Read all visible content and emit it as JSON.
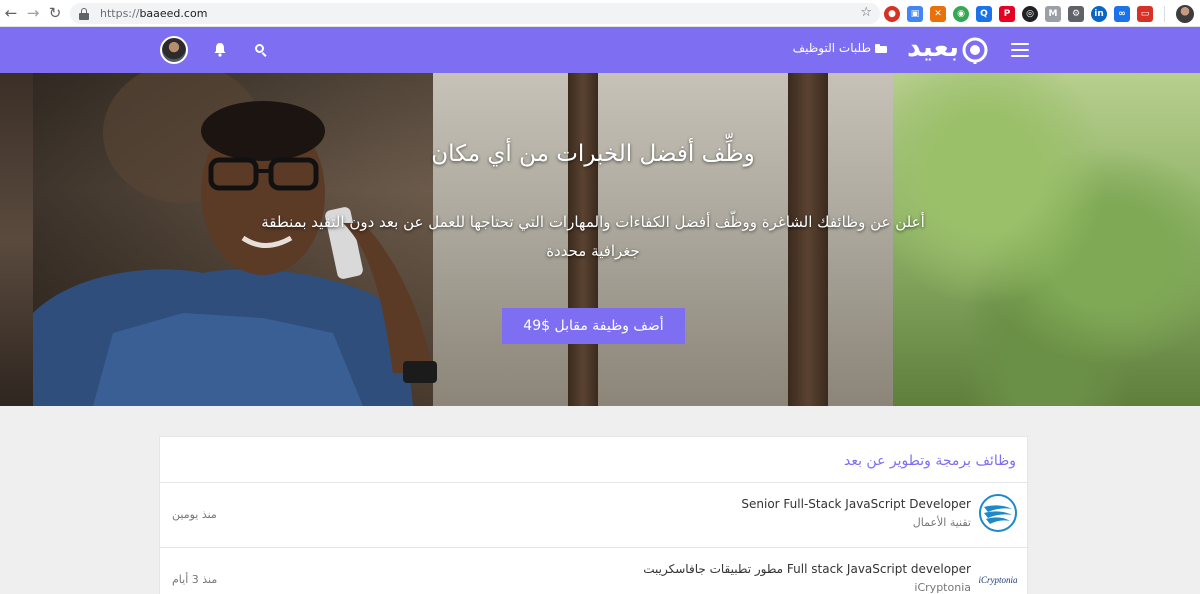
{
  "browser": {
    "url_scheme": "https://",
    "url_host": "baaeed.com",
    "extensions": [
      {
        "name": "adblock-icon",
        "color": "#d93025",
        "glyph": "●"
      },
      {
        "name": "translate-icon",
        "color": "#4285f4",
        "glyph": "▣"
      },
      {
        "name": "tools-icon",
        "color": "#e8710a",
        "glyph": "✕"
      },
      {
        "name": "globe-icon",
        "color": "#34a853",
        "glyph": "◉"
      },
      {
        "name": "qr-icon",
        "color": "#1a73e8",
        "glyph": "Q"
      },
      {
        "name": "pinterest-icon",
        "color": "#e60023",
        "glyph": "P"
      },
      {
        "name": "record-icon",
        "color": "#202124",
        "glyph": "◎"
      },
      {
        "name": "mail-icon",
        "color": "#9aa0a6",
        "glyph": "M"
      },
      {
        "name": "gear-ext-icon",
        "color": "#5f6368",
        "glyph": "⚙"
      },
      {
        "name": "linkedin-icon",
        "color": "#0a66c2",
        "glyph": "in"
      },
      {
        "name": "link-icon",
        "color": "#1a73e8",
        "glyph": "∞"
      },
      {
        "name": "screenshot-icon",
        "color": "#d93025",
        "glyph": "▭"
      }
    ]
  },
  "header": {
    "logo_text": "بعيد",
    "jobs_link_label": "طلبات التوظيف",
    "brand_color": "#7e6ff2"
  },
  "hero": {
    "title": "وظِّف أفضل الخبرات من أي مكان",
    "subtitle": "أعلن عن وظائفك الشاغرة ووظّف أفضل الكفاءات والمهارات التي تحتاجها للعمل عن بعد دون التقيد بمنطقة جغرافية محددة",
    "cta_label": "أضف وظيفة مقابل $49"
  },
  "jobs": {
    "heading": "وظائف برمجة وتطوير عن بعد",
    "items": [
      {
        "title": "Senior Full-Stack JavaScript Developer",
        "company": "تقنية الأعمال",
        "date": "منذ يومين",
        "logo": "swoosh-logo-icon"
      },
      {
        "title": "مطور تطبيقات جافاسكريبت Full stack JavaScript developer",
        "company": "iCryptonia",
        "date": "منذ 3 أيام",
        "logo": "icryptonia-logo-icon",
        "logo_text": "iCryptonia"
      }
    ]
  }
}
